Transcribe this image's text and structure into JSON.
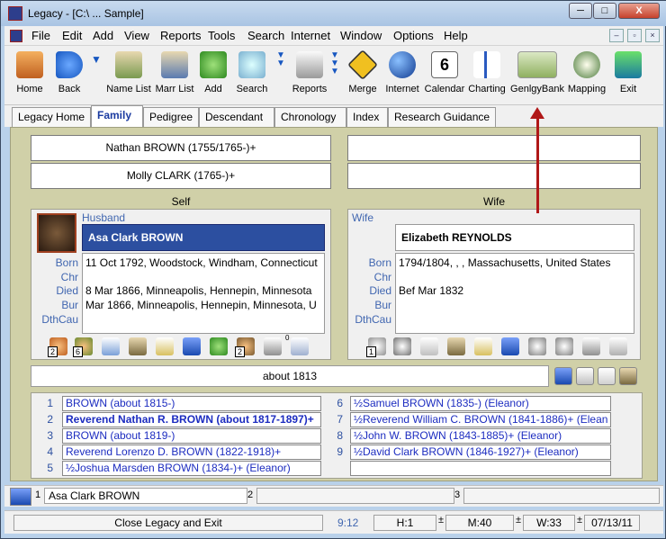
{
  "window": {
    "title": "Legacy - [C:\\ ... Sample]",
    "min_label": "─",
    "max_label": "□",
    "close_label": "X"
  },
  "menu": [
    "File",
    "Edit",
    "Add",
    "View",
    "Reports",
    "Tools",
    "Search",
    "Internet",
    "Window",
    "Options",
    "Help"
  ],
  "toolbar": [
    {
      "label": "Home",
      "icon": "house-icon"
    },
    {
      "label": "Back",
      "icon": "back-arrow-icon"
    },
    {
      "label": "Name List",
      "icon": "name-list-icon"
    },
    {
      "label": "Marr List",
      "icon": "marriage-list-icon"
    },
    {
      "label": "Add",
      "icon": "add-person-icon"
    },
    {
      "label": "Search",
      "icon": "magnifier-icon"
    },
    {
      "label": "Reports",
      "icon": "printer-icon"
    },
    {
      "label": "Merge",
      "icon": "merge-sign-icon"
    },
    {
      "label": "Internet",
      "icon": "globe-icon"
    },
    {
      "label": "Calendar",
      "icon": "calendar-icon"
    },
    {
      "label": "Charting",
      "icon": "chart-icon"
    },
    {
      "label": "GenlgyBank",
      "icon": "leaf-icon"
    },
    {
      "label": "Mapping",
      "icon": "compass-icon"
    },
    {
      "label": "Exit",
      "icon": "exit-door-icon"
    }
  ],
  "calendar_day": "6",
  "tabs": [
    "Legacy Home",
    "Family",
    "Pedigree",
    "Descendant",
    "Chronology",
    "Index",
    "Research Guidance"
  ],
  "active_tab": "Family",
  "parents": {
    "husband_father": "Nathan BROWN (1755/1765-)+",
    "husband_mother": "Molly CLARK (1765-)+",
    "wife_father": "",
    "wife_mother": ""
  },
  "self_label": "Self",
  "wife_label": "Wife",
  "husband": {
    "role": "Husband",
    "name": "Asa Clark BROWN",
    "born": "11 Oct 1792, Woodstock, Windham, Connecticut",
    "chr": "",
    "died": "8 Mar 1866, Minneapolis, Hennepin, Minnesota",
    "bur": "Mar 1866, Minneapolis, Hennepin, Minnesota, U",
    "dthcau": "",
    "icon_counts": [
      "2",
      "6",
      "2",
      "0"
    ]
  },
  "wife": {
    "role": "Wife",
    "name": "Elizabeth REYNOLDS",
    "born": "1794/1804, , , Massachusetts, United States",
    "chr": "",
    "died": "Bef Mar 1832",
    "bur": "",
    "dthcau": "",
    "icon_counts": [
      "1"
    ]
  },
  "field_labels": {
    "born": "Born",
    "chr": "Chr",
    "died": "Died",
    "bur": "Bur",
    "dthcau": "DthCau"
  },
  "marriage": "about 1813",
  "children": [
    {
      "num": "1",
      "text": "BROWN (about 1815-)",
      "bold": false
    },
    {
      "num": "2",
      "text": "Reverend Nathan R. BROWN (about 1817-1897)+",
      "bold": true
    },
    {
      "num": "3",
      "text": "BROWN (about 1819-)",
      "bold": false
    },
    {
      "num": "4",
      "text": "Reverend Lorenzo D. BROWN (1822-1918)+",
      "bold": false
    },
    {
      "num": "5",
      "text": "½Joshua Marsden BROWN (1834-)+ (Eleanor)",
      "bold": false
    },
    {
      "num": "6",
      "text": "½Samuel BROWN (1835-) (Eleanor)",
      "bold": false
    },
    {
      "num": "7",
      "text": "½Reverend William C. BROWN (1841-1886)+ (Elean",
      "bold": false
    },
    {
      "num": "8",
      "text": "½John W. BROWN (1843-1885)+ (Eleanor)",
      "bold": false
    },
    {
      "num": "9",
      "text": "½David Clark BROWN (1846-1927)+ (Eleanor)",
      "bold": false
    }
  ],
  "bookmarks": {
    "n1": "1",
    "name1": "Asa Clark BROWN",
    "n2": "2",
    "n3": "3"
  },
  "status": {
    "message": "Close Legacy and Exit",
    "time": "9:12",
    "h": "H:1",
    "m": "M:40",
    "w": "W:33",
    "date": "07/13/11"
  },
  "colors": {
    "husband_name_bg": "#2c4fa0",
    "panel_bg": "#d0d0a8",
    "arrow": "#b01818"
  }
}
